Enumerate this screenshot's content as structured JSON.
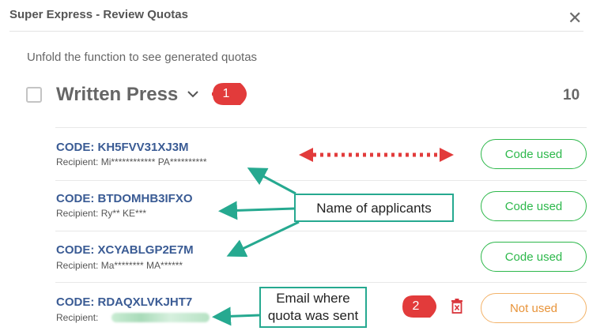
{
  "dialog": {
    "title": "Super Express - Review Quotas",
    "close_glyph": "✕",
    "subtitle": "Unfold the function to see generated quotas"
  },
  "group": {
    "title": "Written Press",
    "count": "10",
    "chevron_icon": "chevron-down-icon"
  },
  "quotas": [
    {
      "code": "CODE: KH5FVV31XJ3M",
      "recipient": "Recipient: Mi************ PA**********",
      "status": "Code used"
    },
    {
      "code": "CODE: BTDOMHB3IFXO",
      "recipient": "Recipient: Ry** KE***",
      "status": "Code used"
    },
    {
      "code": "CODE: XCYABLGP2E7M",
      "recipient": "Recipient: Ma******** MA******",
      "status": "Code used"
    },
    {
      "code": "CODE: RDAQXLVKJHT7",
      "recipient": "Recipient:",
      "status": "Not used",
      "delete_icon": "trash-icon"
    }
  ],
  "annotations": {
    "badge_1": "1",
    "badge_2": "2",
    "note_applicants": "Name of applicants",
    "note_email": "Email where\nquota was sent",
    "colors": {
      "badge": "#e23b3b",
      "arrow_teal": "#26a990",
      "arrow_red": "#e23b3b"
    }
  },
  "colors": {
    "code_text": "#3a5b94",
    "used_pill": "#2db84b",
    "not_used_pill": "#f3b36a",
    "delete_icon": "#d9343a"
  }
}
